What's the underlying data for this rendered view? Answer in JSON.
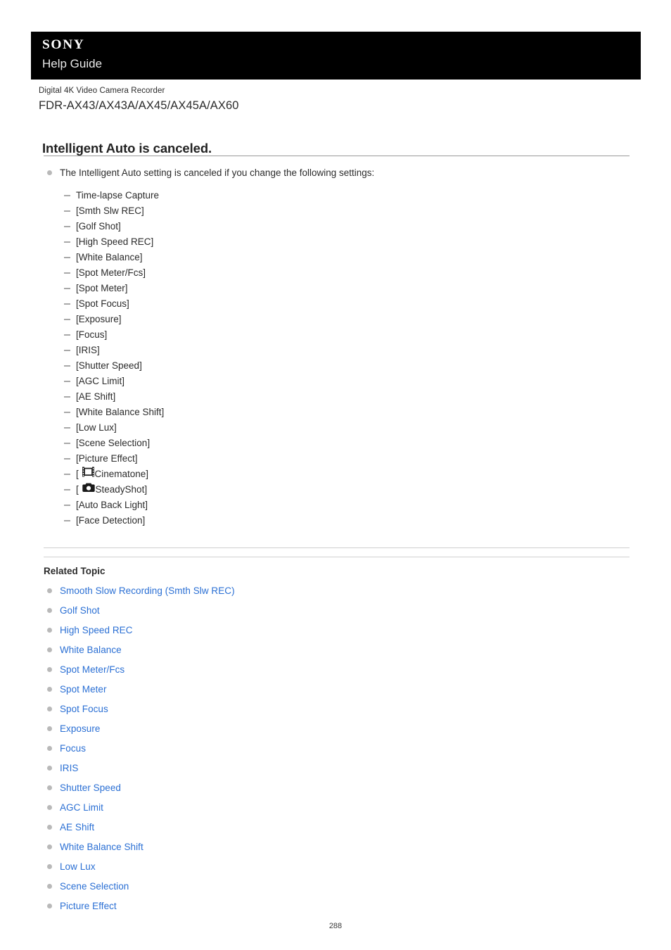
{
  "header": {
    "brand": "SONY",
    "subtitle": "Help Guide"
  },
  "product": {
    "kicker": "Digital 4K Video Camera Recorder",
    "model": "FDR-AX43/AX43A/AX45/AX45A/AX60"
  },
  "page": {
    "title": "Intelligent Auto is canceled.",
    "number": "288"
  },
  "main": {
    "lead": "The Intelligent Auto setting is canceled if you change the following settings:",
    "settings": [
      {
        "label": "Time-lapse Capture",
        "icon": null
      },
      {
        "label": "[Smth Slw REC]",
        "icon": null
      },
      {
        "label": "[Golf Shot]",
        "icon": null
      },
      {
        "label": "[High Speed REC]",
        "icon": null
      },
      {
        "label": "[White Balance]",
        "icon": null
      },
      {
        "label": "[Spot Meter/Fcs]",
        "icon": null
      },
      {
        "label": "[Spot Meter]",
        "icon": null
      },
      {
        "label": "[Spot Focus]",
        "icon": null
      },
      {
        "label": "[Exposure]",
        "icon": null
      },
      {
        "label": "[Focus]",
        "icon": null
      },
      {
        "label": "[IRIS]",
        "icon": null
      },
      {
        "label": "[Shutter Speed]",
        "icon": null
      },
      {
        "label": "[AGC Limit]",
        "icon": null
      },
      {
        "label": "[AE Shift]",
        "icon": null
      },
      {
        "label": "[White Balance Shift]",
        "icon": null
      },
      {
        "label": "[Low Lux]",
        "icon": null
      },
      {
        "label": "[Scene Selection]",
        "icon": null
      },
      {
        "label": "[Picture Effect]",
        "icon": null
      },
      {
        "prefix": "[ ",
        "icon": "film-strip-icon",
        "suffix": "Cinematone]"
      },
      {
        "prefix": "[ ",
        "icon": "camera-icon",
        "suffix": "SteadyShot]"
      },
      {
        "label": "[Auto Back Light]",
        "icon": null
      },
      {
        "label": "[Face Detection]",
        "icon": null
      }
    ]
  },
  "related": {
    "heading": "Related Topic",
    "links": [
      "Smooth Slow Recording (Smth Slw REC)",
      "Golf Shot",
      "High Speed REC",
      "White Balance",
      "Spot Meter/Fcs",
      "Spot Meter",
      "Spot Focus",
      "Exposure",
      "Focus",
      "IRIS",
      "Shutter Speed",
      "AGC Limit",
      "AE Shift",
      "White Balance Shift",
      "Low Lux",
      "Scene Selection",
      "Picture Effect"
    ]
  },
  "colors": {
    "link": "#2a6fd4",
    "bullet": "#b9b9b9",
    "dash": "#a8a8a8",
    "header_bg": "#000000",
    "rule": "#cfcfcf"
  }
}
